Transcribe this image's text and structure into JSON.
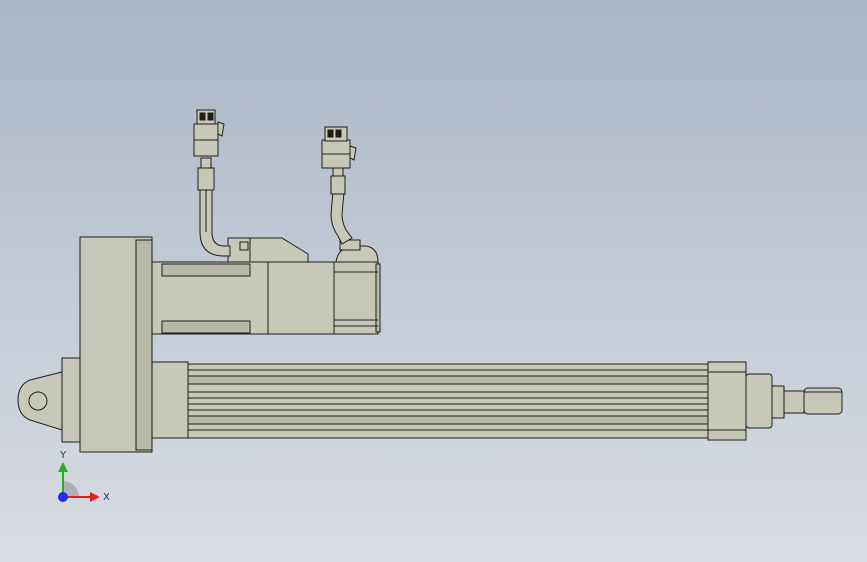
{
  "viewport": {
    "background_top": "#aab4c4",
    "background_bottom": "#d9dde3",
    "part_fill": "#c8c8b9",
    "part_shade": "#b9b9aa",
    "edge_color": "#1e1e1e"
  },
  "triad": {
    "x_label": "X",
    "y_label": "Y",
    "x_color": "#e02020",
    "y_color": "#20b020",
    "z_color": "#2030e0"
  }
}
